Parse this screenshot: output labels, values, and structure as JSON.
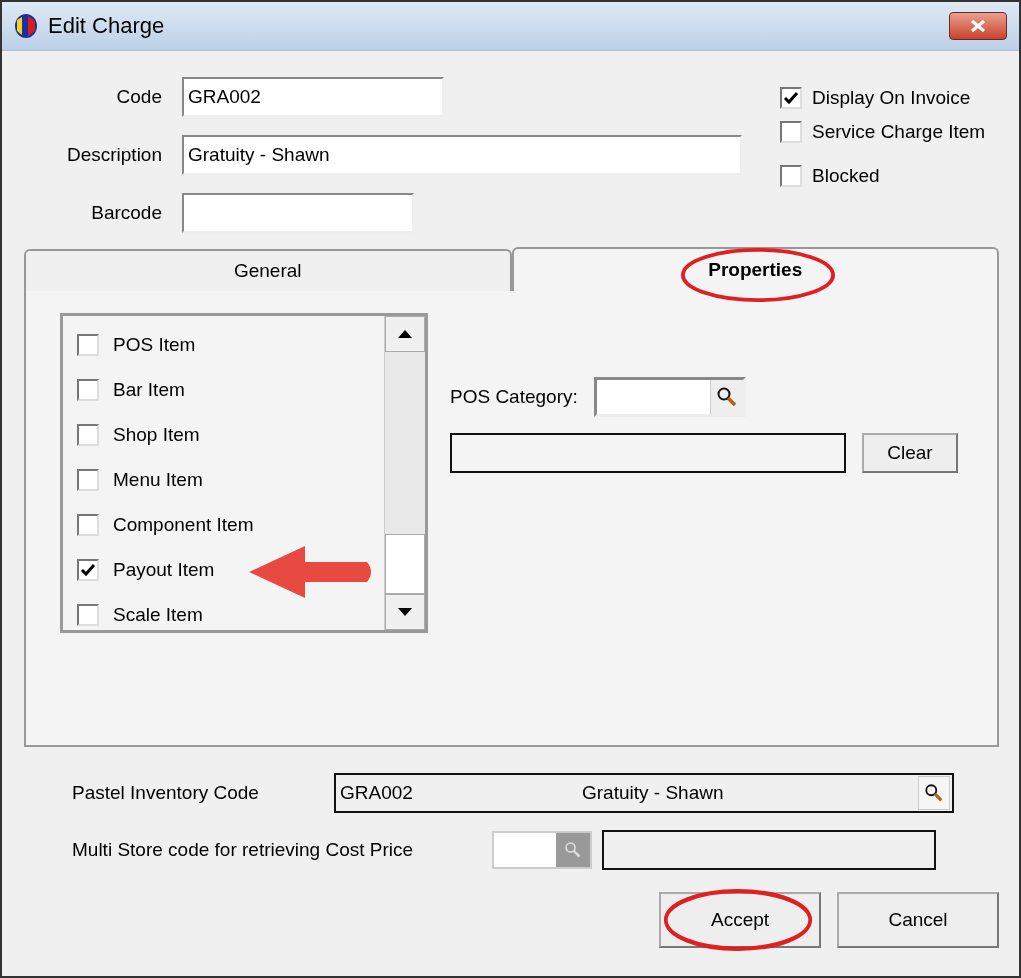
{
  "window": {
    "title": "Edit Charge"
  },
  "fields": [
    {
      "label": "Code",
      "value": "GRA002"
    },
    {
      "label": "Description",
      "value": "Gratuity - Shawn"
    },
    {
      "label": "Barcode"
    }
  ],
  "options": [
    {
      "label": "Display On Invoice",
      "checked": true
    },
    {
      "label": "Service Charge Item",
      "checked": false
    },
    {
      "label": "Blocked",
      "checked": false
    }
  ],
  "tabs": [
    {
      "label": "General",
      "selected": false,
      "highlighted": false
    },
    {
      "label": "Properties",
      "selected": true,
      "highlighted": true
    }
  ],
  "item_types": [
    {
      "label": "POS Item",
      "checked": false,
      "pointed": false
    },
    {
      "label": "Bar Item",
      "checked": false,
      "pointed": false
    },
    {
      "label": "Shop Item",
      "checked": false,
      "pointed": false
    },
    {
      "label": "Menu Item",
      "checked": false,
      "pointed": false
    },
    {
      "label": "Component Item",
      "checked": false,
      "pointed": false
    },
    {
      "label": "Payout Item",
      "checked": true,
      "pointed": true
    },
    {
      "label": "Scale Item",
      "checked": false,
      "pointed": false
    }
  ],
  "pos_category": {
    "label": "POS Category:",
    "clear_button": "Clear"
  },
  "pastel": {
    "label": "Pastel Inventory Code",
    "code": "GRA002",
    "description": "Gratuity - Shawn"
  },
  "multi_store": {
    "label": "Multi Store code for retrieving Cost Price"
  },
  "buttons": [
    {
      "label": "Accept",
      "highlighted": true
    },
    {
      "label": "Cancel",
      "highlighted": false
    }
  ]
}
